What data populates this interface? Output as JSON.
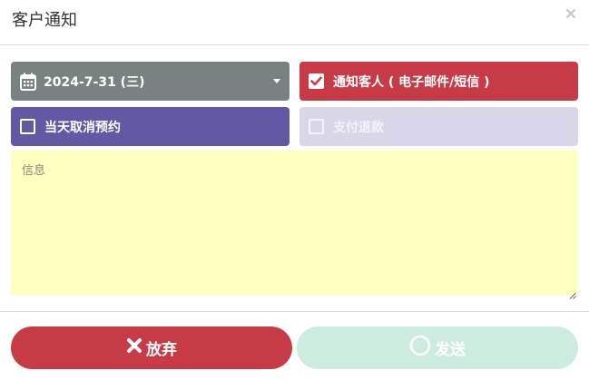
{
  "dialog": {
    "title": "客户通知",
    "close_icon": "close-icon"
  },
  "date_picker": {
    "value": "2024-7-31 (三)",
    "icon": "calendar-icon"
  },
  "options": {
    "notify_customer": {
      "label": "通知客人 ( 电子邮件/短信 )",
      "checked": true
    },
    "cancel_today": {
      "label": "当天取消预约",
      "checked": false
    },
    "payment_refund": {
      "label": "支付退款",
      "checked": false,
      "disabled": true
    }
  },
  "message": {
    "placeholder": "信息",
    "value": ""
  },
  "footer": {
    "discard_label": "放弃",
    "discard_icon": "x-icon",
    "send_label": "发送",
    "send_icon": "circle-icon",
    "send_disabled": true
  },
  "colors": {
    "date_bg": "#7a8281",
    "notify_bg": "#c63b46",
    "cancel_bg": "#6258a4",
    "refund_bg": "#d9d6e9",
    "message_bg": "#ffffc1",
    "discard_bg": "#c63b46",
    "send_bg": "#cdece0"
  }
}
